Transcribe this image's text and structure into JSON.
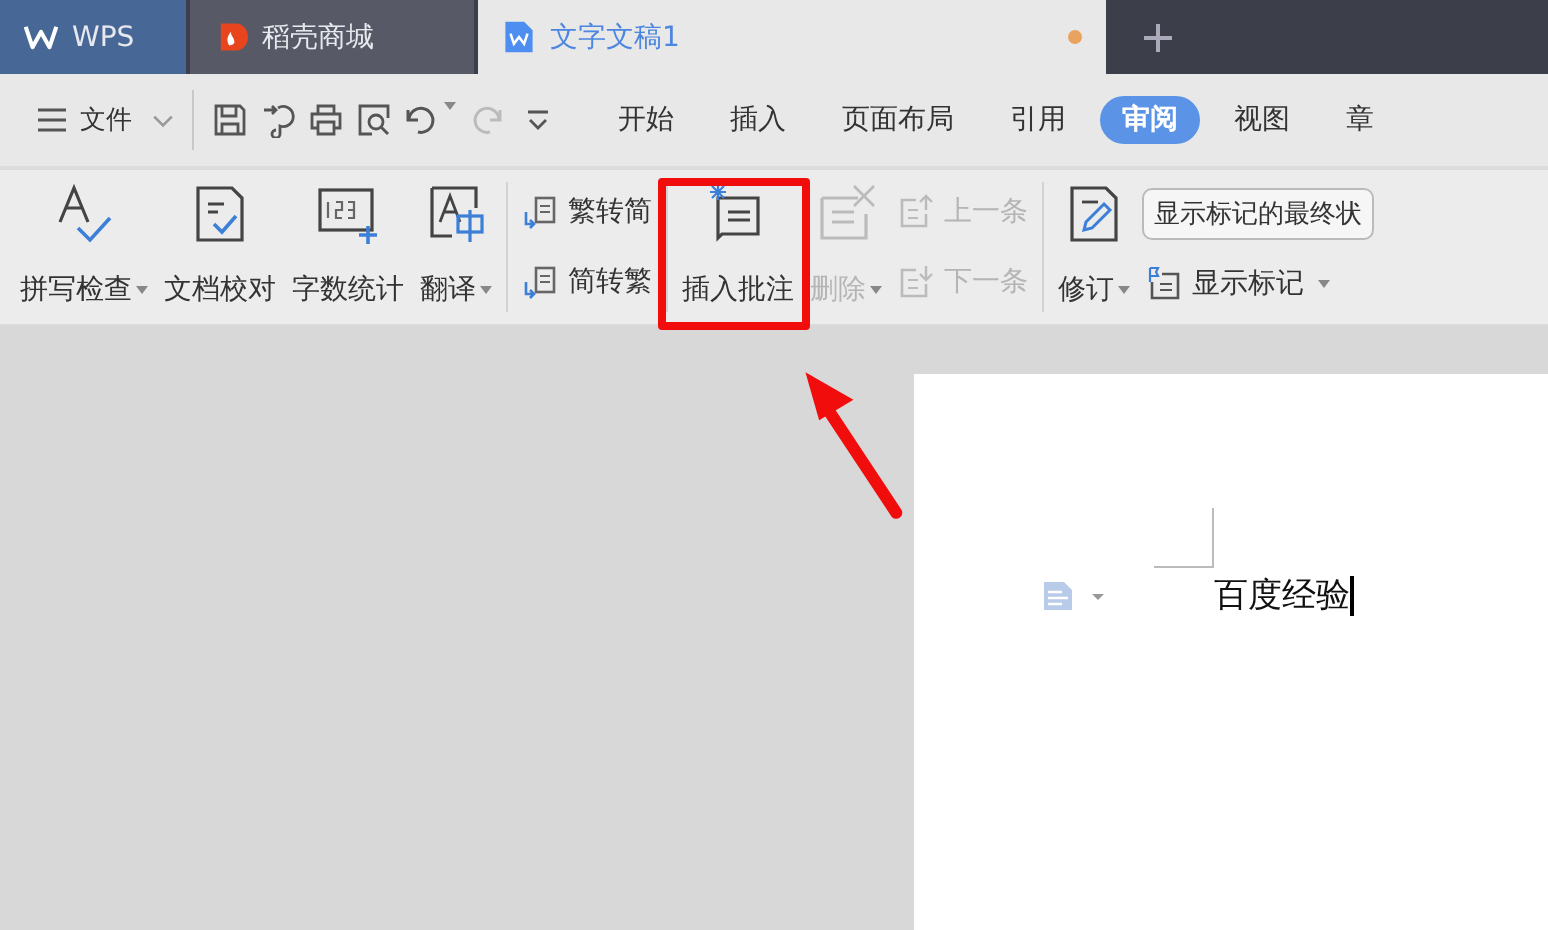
{
  "title_tabs": [
    {
      "kind": "home",
      "label": "WPS",
      "selected": false,
      "unsaved": false
    },
    {
      "kind": "store",
      "label": "稻壳商城",
      "selected": false,
      "unsaved": false
    },
    {
      "kind": "document",
      "label": "文字文稿1",
      "selected": true,
      "unsaved": true
    }
  ],
  "menu": {
    "file_label": "文件",
    "quick_access": [
      {
        "kind": "save",
        "disabled": false
      },
      {
        "kind": "painter",
        "disabled": false
      },
      {
        "kind": "print",
        "disabled": false
      },
      {
        "kind": "preview",
        "disabled": false
      },
      {
        "kind": "undo",
        "disabled": false
      },
      {
        "kind": "redo",
        "disabled": true
      },
      {
        "kind": "more",
        "disabled": false
      }
    ],
    "tabs": [
      {
        "label": "开始",
        "selected": false
      },
      {
        "label": "插入",
        "selected": false
      },
      {
        "label": "页面布局",
        "selected": false
      },
      {
        "label": "引用",
        "selected": false
      },
      {
        "label": "审阅",
        "selected": true
      },
      {
        "label": "视图",
        "selected": false
      },
      {
        "label": "章",
        "selected": false
      }
    ]
  },
  "ribbon": [
    {
      "kind": "spell",
      "label": "拼写检查",
      "dropdown": true,
      "disabled": false
    },
    {
      "kind": "proof",
      "label": "文档校对",
      "dropdown": false,
      "disabled": false
    },
    {
      "kind": "count",
      "label": "字数统计",
      "dropdown": false,
      "disabled": false
    },
    {
      "kind": "translate",
      "label": "翻译",
      "dropdown": true,
      "disabled": false
    },
    {
      "kind": "separator"
    },
    {
      "kind": "stack",
      "items": [
        {
          "kind": "to-simple",
          "label": "繁转简",
          "dropdown": false,
          "disabled": false
        },
        {
          "kind": "to-trad",
          "label": "简转繁",
          "dropdown": false,
          "disabled": false
        }
      ]
    },
    {
      "kind": "separator"
    },
    {
      "kind": "comment",
      "label": "插入批注",
      "dropdown": false,
      "disabled": false
    },
    {
      "kind": "delete",
      "label": "删除",
      "dropdown": true,
      "disabled": true
    },
    {
      "kind": "stack",
      "items": [
        {
          "kind": "prev",
          "label": "上一条",
          "dropdown": false,
          "disabled": true
        },
        {
          "kind": "next",
          "label": "下一条",
          "dropdown": false,
          "disabled": true
        }
      ]
    },
    {
      "kind": "separator"
    },
    {
      "kind": "revise",
      "label": "修订",
      "dropdown": true,
      "disabled": false
    },
    {
      "kind": "stack",
      "items": [
        {
          "kind": "select",
          "label": "显示标记的最终状",
          "dropdown": false,
          "disabled": false
        },
        {
          "kind": "markup",
          "label": "显示标记",
          "dropdown": true,
          "disabled": false
        }
      ]
    }
  ],
  "document": {
    "text": "百度经验"
  }
}
